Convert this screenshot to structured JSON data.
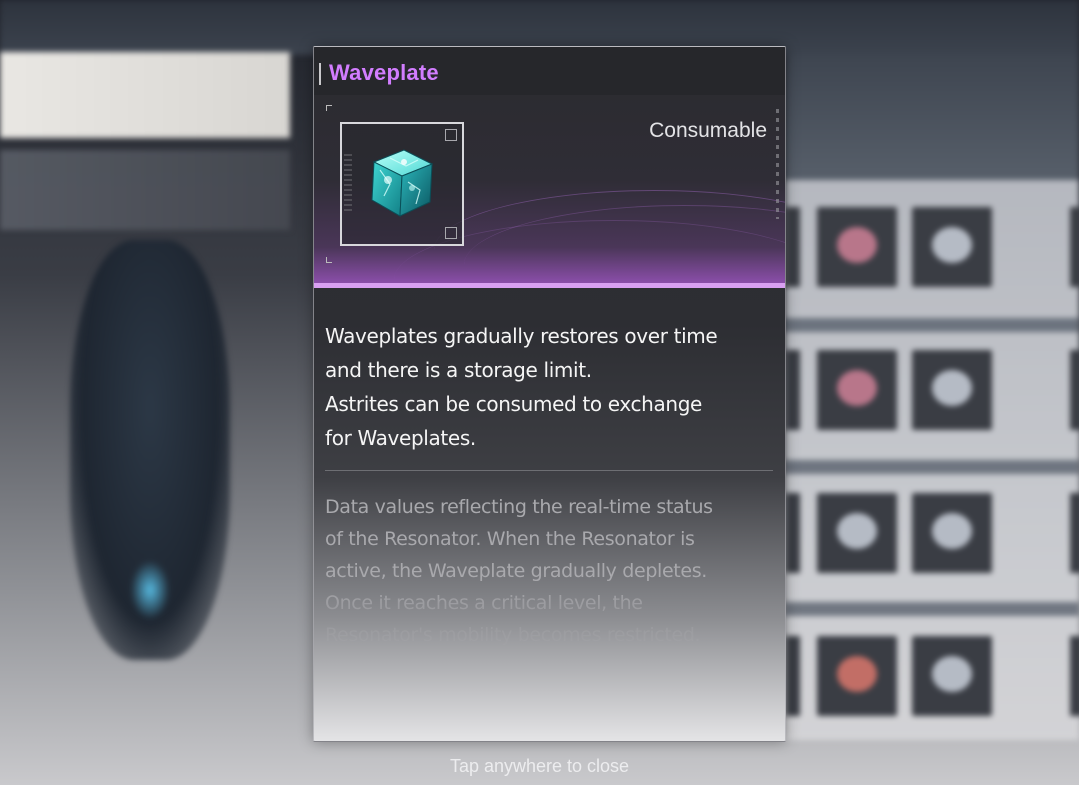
{
  "tooltip": {
    "title": "Waveplate",
    "item_type": "Consumable",
    "icon": "waveplate-cube-icon",
    "description_lines": [
      "Waveplates gradually restores over time",
      "and there is a storage limit.",
      "Astrites can be consumed to exchange",
      "for Waveplates."
    ],
    "lore_lines": [
      "Data values reflecting the real-time status",
      "of the Resonator. When the Resonator is",
      "active, the Waveplate gradually depletes.",
      "Once it reaches a critical level, the",
      "Resonator's mobility becomes restricted."
    ]
  },
  "close_hint": "Tap anywhere to close",
  "colors": {
    "title": "#d27dff",
    "banner_accent": "#d9a0f2",
    "icon_cube": "#3fd6d2"
  }
}
